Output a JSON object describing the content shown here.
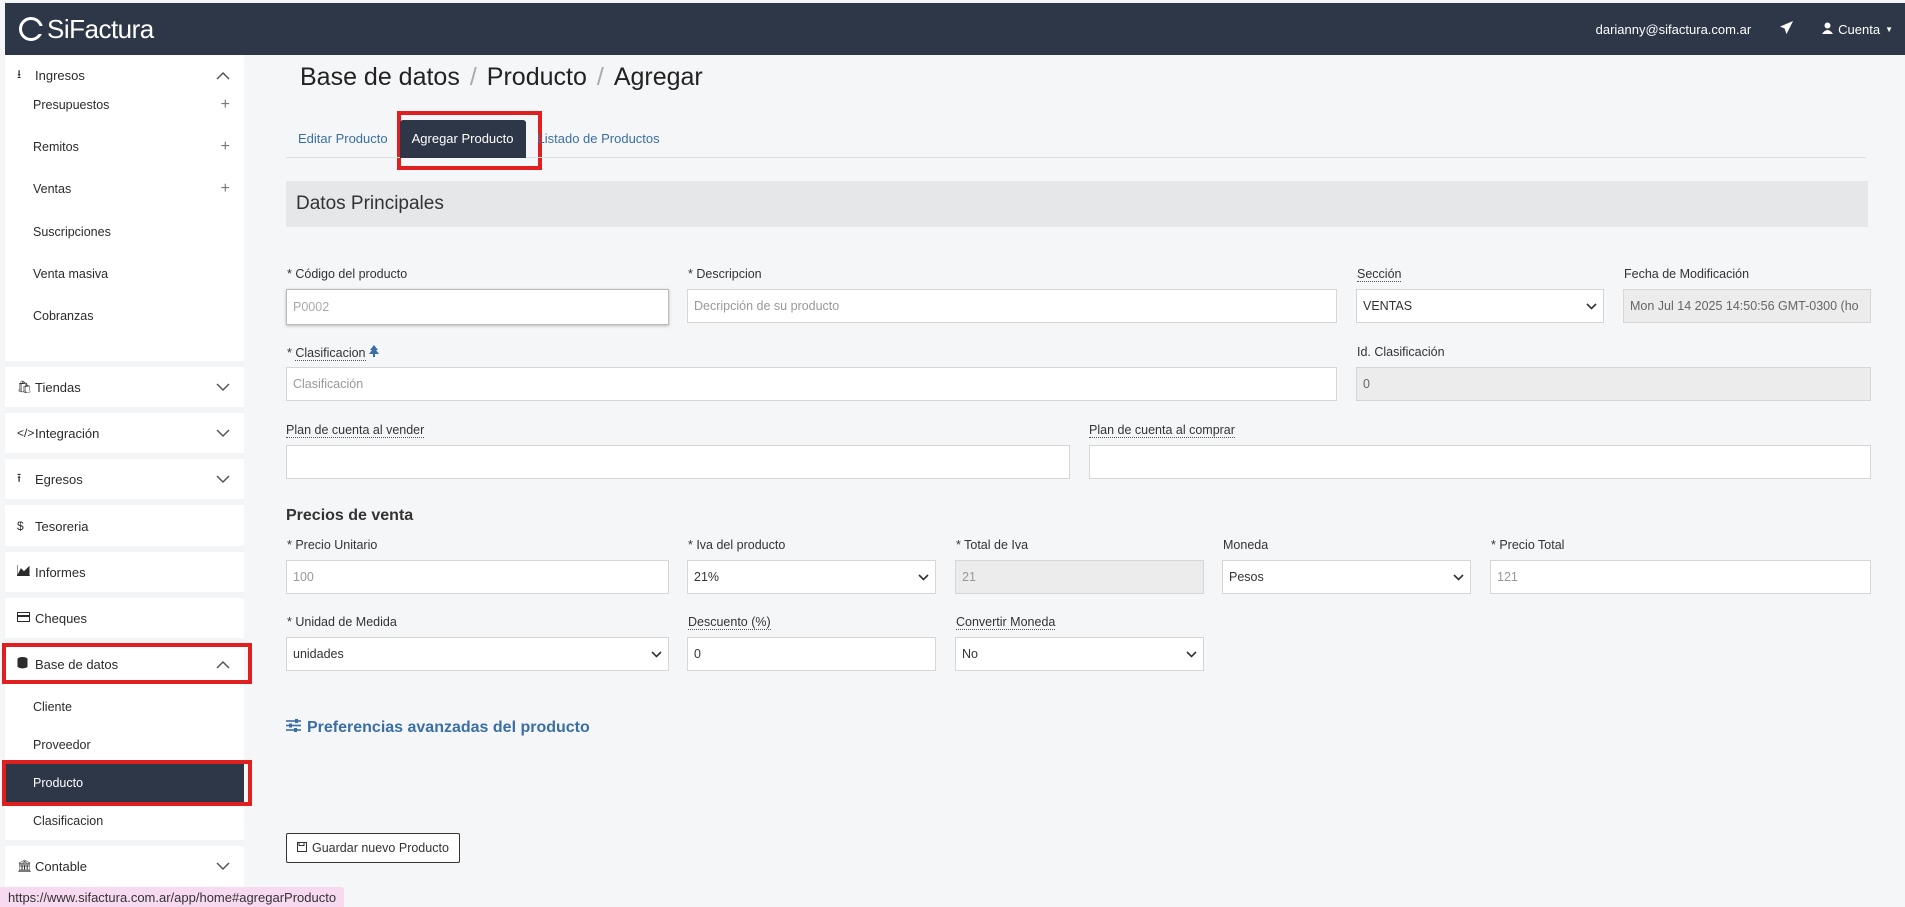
{
  "header": {
    "brand": "SiFactura",
    "user_email": "darianny@sifactura.com.ar",
    "account_label": "Cuenta"
  },
  "sidebar": {
    "ingresos": "Ingresos",
    "ingresos_items": [
      "Presupuestos",
      "Remitos",
      "Ventas",
      "Suscripciones",
      "Venta masiva",
      "Cobranzas"
    ],
    "tiendas": "Tiendas",
    "integracion": "Integración",
    "egresos": "Egresos",
    "tesoreria": "Tesoreria",
    "informes": "Informes",
    "cheques": "Cheques",
    "base_datos": "Base de datos",
    "base_items": [
      "Cliente",
      "Proveedor",
      "Producto",
      "Clasificacion"
    ],
    "contable": "Contable"
  },
  "breadcrumb": [
    "Base de datos",
    "Producto",
    "Agregar"
  ],
  "tabs": [
    "Editar Producto",
    "Agregar Producto",
    "Listado de Productos"
  ],
  "section_title": "Datos Principales",
  "form": {
    "codigo_label": "* Código del producto",
    "codigo_value": "P0002",
    "descripcion_label": "* Descripcion",
    "descripcion_placeholder": "Decripción de su producto",
    "seccion_label": "Sección",
    "seccion_value": "VENTAS",
    "fecha_label": "Fecha de Modificación",
    "fecha_value": "Mon Jul 14 2025 14:50:56 GMT-0300 (ho",
    "clasificacion_label_prefix": "* ",
    "clasificacion_label": "Clasificacion",
    "clasificacion_placeholder": "Clasificación",
    "id_clasificacion_label": "Id. Clasificación",
    "id_clasificacion_value": "0",
    "plan_vender_label": "Plan de cuenta al vender",
    "plan_comprar_label": "Plan de cuenta al comprar"
  },
  "precios": {
    "title": "Precios de venta",
    "precio_unitario_label": "* Precio Unitario",
    "precio_unitario_value": "100",
    "iva_label": "* Iva del producto",
    "iva_value": "21%",
    "total_iva_label": "* Total de Iva",
    "total_iva_value": "21",
    "moneda_label": "Moneda",
    "moneda_value": "Pesos",
    "precio_total_label": "* Precio Total",
    "precio_total_value": "121",
    "unidad_label": "* Unidad de Medida",
    "unidad_value": "unidades",
    "descuento_label": "Descuento (%)",
    "descuento_value": "0",
    "convertir_label": "Convertir Moneda",
    "convertir_value": "No"
  },
  "advanced_link": "Preferencias avanzadas del producto",
  "save_button": "Guardar nuevo Producto",
  "status_url": "https://www.sifactura.com.ar/app/home#agregarProducto",
  "colors": {
    "navy": "#2d3748",
    "link": "#3a6fa5",
    "highlight": "#e02020"
  }
}
